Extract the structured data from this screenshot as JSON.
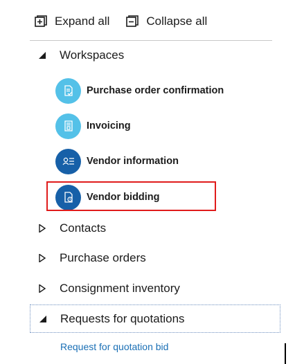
{
  "toolbar": {
    "expand_all_label": "Expand all",
    "collapse_all_label": "Collapse all"
  },
  "groups": {
    "workspaces": {
      "label": "Workspaces",
      "state": "expanded"
    },
    "contacts": {
      "label": "Contacts",
      "state": "collapsed"
    },
    "purchase_orders": {
      "label": "Purchase orders",
      "state": "collapsed"
    },
    "consignment_inventory": {
      "label": "Consignment inventory",
      "state": "collapsed"
    },
    "requests_for_quotations": {
      "label": "Requests for quotations",
      "state": "expanded"
    }
  },
  "workspaces": [
    {
      "label": "Purchase order confirmation",
      "icon": "document-check-icon",
      "color": "#54c1e8"
    },
    {
      "label": "Invoicing",
      "icon": "invoice-icon",
      "color": "#54c1e8"
    },
    {
      "label": "Vendor information",
      "icon": "contact-list-icon",
      "color": "#1760a8"
    },
    {
      "label": "Vendor bidding",
      "icon": "bid-document-icon",
      "color": "#1760a8"
    }
  ],
  "rfq_links": [
    {
      "label": "Request for quotation bid"
    }
  ],
  "colors": {
    "highlight": "#e01b1b",
    "link": "#1a6fb5",
    "light_tile": "#54c1e8",
    "dark_tile": "#1760a8"
  }
}
